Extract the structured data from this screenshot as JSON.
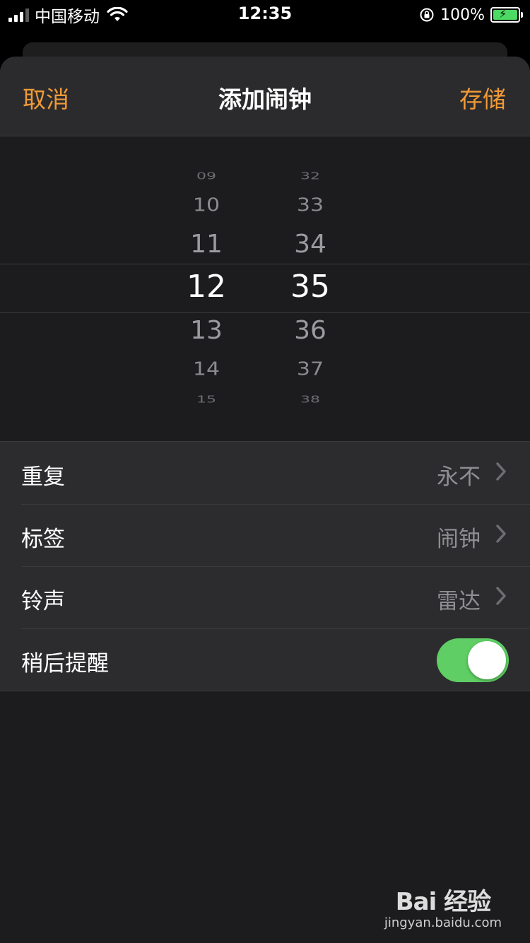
{
  "status_bar": {
    "carrier": "中国移动",
    "time": "12:35",
    "battery_percent": "100%",
    "battery_level": 1.0,
    "signal_bars_filled": 3,
    "signal_bars_total": 4
  },
  "nav": {
    "cancel_label": "取消",
    "title": "添加闹钟",
    "save_label": "存储"
  },
  "time_picker": {
    "hours": {
      "above": [
        "09",
        "10",
        "11"
      ],
      "selected": "12",
      "below": [
        "13",
        "14",
        "15"
      ]
    },
    "minutes": {
      "above": [
        "32",
        "33",
        "34"
      ],
      "selected": "35",
      "below": [
        "36",
        "37",
        "38"
      ]
    }
  },
  "settings": {
    "repeat": {
      "label": "重复",
      "value": "永不"
    },
    "label_row": {
      "label": "标签",
      "value": "闹钟"
    },
    "sound": {
      "label": "铃声",
      "value": "雷达"
    },
    "snooze": {
      "label": "稍后提醒",
      "enabled": true
    }
  },
  "watermark": {
    "brand": "Bai  经验",
    "url": "jingyan.baidu.com"
  },
  "colors": {
    "accent": "#f19a37",
    "toggle_on": "#5fce64",
    "background": "#1c1c1e",
    "row_background": "#2c2c2e"
  }
}
